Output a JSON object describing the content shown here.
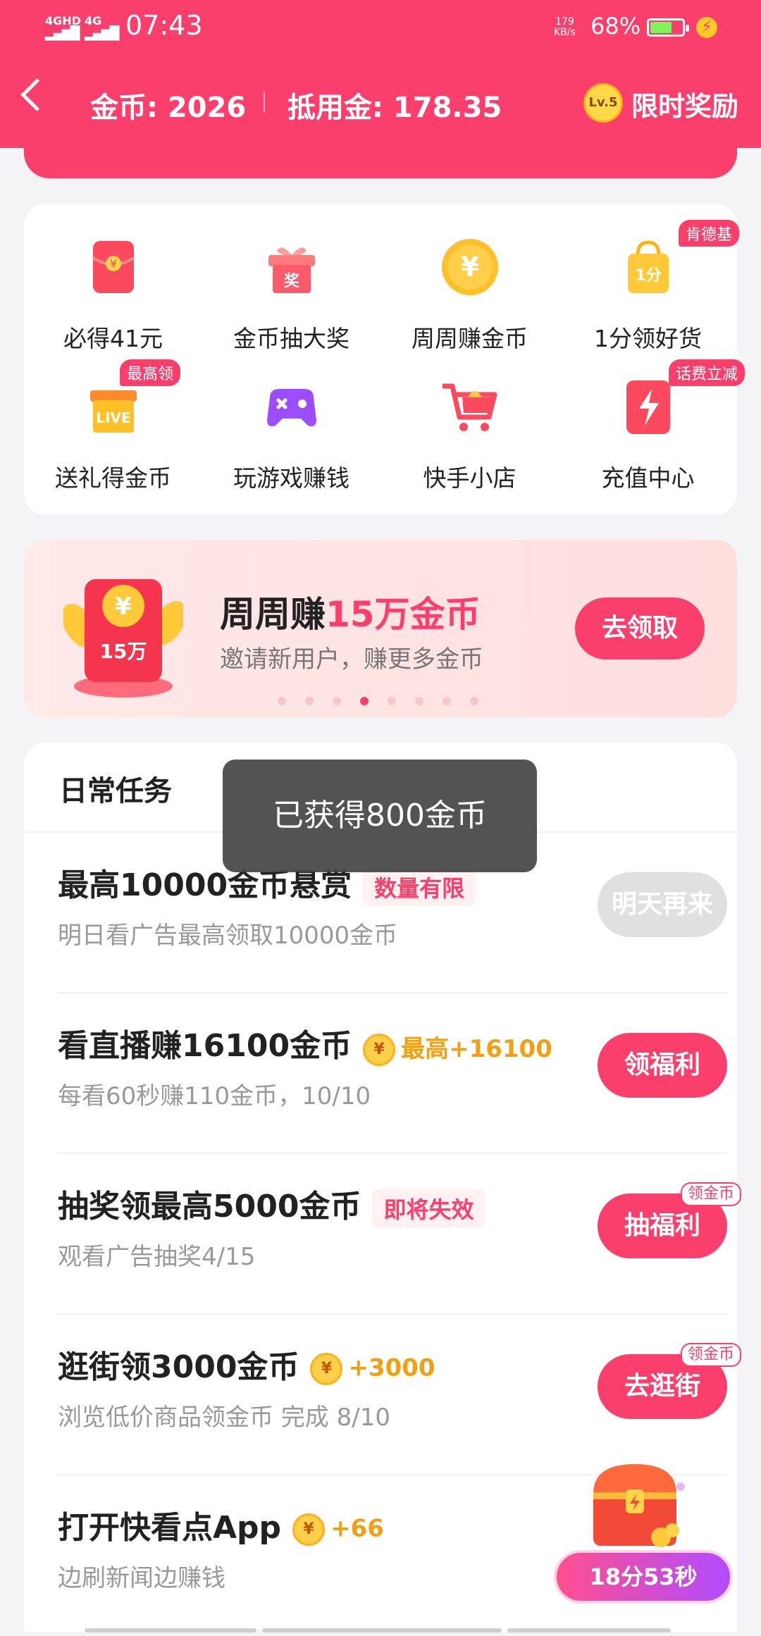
{
  "statusbar": {
    "sim1": "4GHD",
    "sim2": "4G",
    "time": "07:43",
    "netspeed_value": "179",
    "netspeed_unit": "KB/s",
    "battery_pct": "68%",
    "battery_level": 0.68
  },
  "navbar": {
    "coins": "金币: 2026",
    "offset_amount": "抵用金: 178.35",
    "level": "Lv.5",
    "limited_reward": "限时奖励"
  },
  "grid": [
    {
      "label": "必得41元",
      "icon": "red-envelope-icon",
      "badge": ""
    },
    {
      "label": "金币抽大奖",
      "icon": "gift-box-icon",
      "badge": ""
    },
    {
      "label": "周周赚金币",
      "icon": "yuan-coin-icon",
      "badge": ""
    },
    {
      "label": "1分领好货",
      "icon": "shopping-bag-icon",
      "badge": "肯德基"
    },
    {
      "label": "送礼得金币",
      "icon": "live-gift-icon",
      "badge": "最高领"
    },
    {
      "label": "玩游戏赚钱",
      "icon": "gamepad-icon",
      "badge": ""
    },
    {
      "label": "快手小店",
      "icon": "shopping-cart-icon",
      "badge": ""
    },
    {
      "label": "充值中心",
      "icon": "lightning-icon",
      "badge": "话费立减"
    }
  ],
  "gift_char": "奖",
  "bag_char": "1分",
  "live_text": "LIVE",
  "yuan_symbol": "¥",
  "banner": {
    "title_prefix": "周周赚",
    "title_highlight": "15万金币",
    "subtitle": "邀请新用户，赚更多金币",
    "button": "去领取",
    "envelope_text": "15万",
    "dot_count": 8,
    "active_dot": 3
  },
  "tasks": {
    "heading": "日常任务",
    "items": [
      {
        "title": "最高10000金币悬赏",
        "tag": "数量有限",
        "gold": "",
        "desc": "明日看广告最高领取10000金币",
        "button": "明天再来",
        "button_badge": "",
        "disabled": true
      },
      {
        "title": "看直播赚16100金币",
        "tag": "",
        "gold": "最高+16100",
        "desc": "每看60秒赚110金币，10/10",
        "button": "领福利",
        "button_badge": "",
        "disabled": false
      },
      {
        "title": "抽奖领最高5000金币",
        "tag": "即将失效",
        "gold": "",
        "desc": "观看广告抽奖4/15",
        "button": "抽福利",
        "button_badge": "领金币",
        "disabled": false
      },
      {
        "title": "逛街领3000金币",
        "tag": "",
        "gold": "+3000",
        "desc": "浏览低价商品领金币 完成 8/10",
        "button": "去逛街",
        "button_badge": "领金币",
        "disabled": false
      },
      {
        "title": "打开快看点App",
        "tag": "",
        "gold": "+66",
        "desc": "边刷新闻边赚钱",
        "button": "",
        "button_badge": "",
        "disabled": false
      }
    ]
  },
  "toast": "已获得800金币",
  "chest_timer": "18分53秒",
  "colors": {
    "brand": "#fb3f6c",
    "gold": "#f29f14",
    "disabled": "#e0e0e0"
  }
}
